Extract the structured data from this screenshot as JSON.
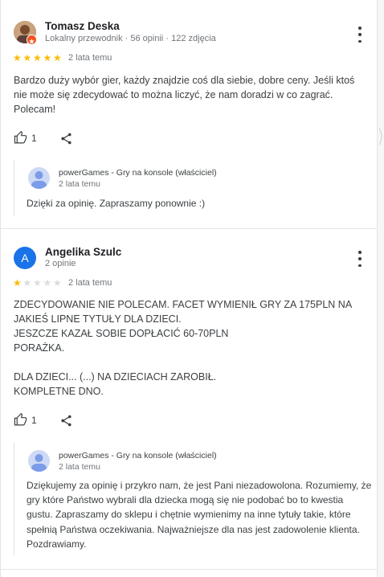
{
  "reviews": [
    {
      "author": "Tomasz Deska",
      "meta": "Lokalny przewodnik · 56 opinii · 122 zdjęcia",
      "rating": 5,
      "time": "2 lata temu",
      "text": "Bardzo duży wybór gier, każdy znajdzie coś dla siebie, dobre ceny. Jeśli ktoś nie może się zdecydować to można liczyć, że nam doradzi w co zagrać. Polecam!",
      "likes": "1",
      "reply": {
        "owner": "powerGames - Gry na konsole (właściciel)",
        "time": "2 lata temu",
        "text": "Dzięki za opinię. Zapraszamy ponownie :)"
      }
    },
    {
      "author": "Angelika Szulc",
      "avatar_letter": "A",
      "meta": "2 opinie",
      "rating": 1,
      "time": "2 lata temu",
      "text": "ZDECYDOWANIE NIE POLECAM. FACET WYMIENIŁ GRY ZA 175PLN NA JAKIEŚ LIPNE TYTUŁY DLA DZIECI.\nJESZCZE KAZAŁ SOBIE DOPŁACIĆ 60-70PLN\nPORAŻKA.\n\nDLA DZIECI... (...) NA DZIECIACH ZAROBIŁ.\nKOMPLETNE DNO.",
      "likes": "1",
      "reply": {
        "owner": "powerGames - Gry na konsole (właściciel)",
        "time": "2 lata temu",
        "text": "Dziękujemy za opinię i przykro nam, że jest Pani niezadowolona. Rozumiemy, że gry które Państwo wybrali dla dziecka mogą się nie podobać bo to kwestia gustu. Zapraszamy do sklepu i chętnie wymienimy na inne tytuły takie, które spełnią Państwa oczekiwania. Najważniejsze dla nas jest zadowolenie klienta. Pozdrawiamy."
      }
    }
  ],
  "icons": {
    "like": "thumb-up-icon",
    "share": "share-icon",
    "more": "more-vert-icon",
    "badge": "local-guide-badge-icon"
  },
  "colors": {
    "star": "#fbbc04",
    "star_empty": "#dadce0",
    "avatar_a": "#1a73e8",
    "badge": "#f4511e"
  }
}
